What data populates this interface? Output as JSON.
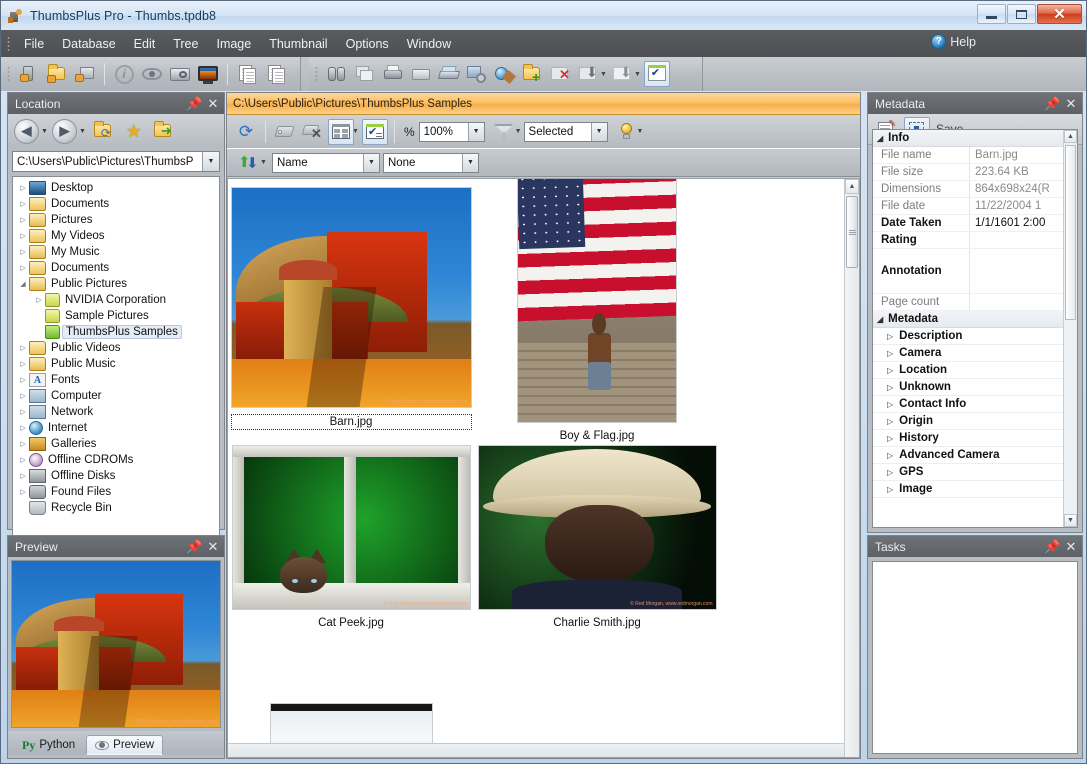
{
  "window": {
    "title": "ThumbsPlus Pro - Thumbs.tpdb8",
    "app_icon": "thumbsplus-icon",
    "minimize": "–",
    "maximize": "❐",
    "close": "✕"
  },
  "menubar": {
    "items": [
      "File",
      "Database",
      "Edit",
      "Tree",
      "Image",
      "Thumbnail",
      "Options",
      "Window"
    ],
    "help_label": "Help",
    "help_icon": "help-question-icon"
  },
  "toolbar": {
    "groups": [
      {
        "icons": [
          "thumbnail-scan-icon",
          "folder-scan-icon",
          "image-scan-icon"
        ]
      },
      {
        "icons": [
          "info-icon",
          "view-icon",
          "slideshow-icon",
          "fullscreen-view-icon"
        ]
      },
      {
        "icons": [
          "copy-icon",
          "paste-icon"
        ]
      },
      {
        "icons": [
          "find-icon",
          "duplicate-icon",
          "print-icon",
          "email-icon",
          "scanner-icon",
          "image-settings-icon",
          "web-gallery-icon",
          "new-folder-icon",
          "delete-folder-icon",
          "move-down-icon",
          "copy-down-icon",
          "select-checkbox-icon"
        ]
      }
    ]
  },
  "location_panel": {
    "caption": "Location",
    "pin_icon": "pin-icon",
    "close_icon": "close-icon",
    "nav": {
      "back_icon": "back-arrow-icon",
      "forward_icon": "forward-arrow-icon",
      "refresh_folder_icon": "refresh-folder-icon",
      "favorites_icon": "star-favorites-icon",
      "go_folder_icon": "go-folder-icon"
    },
    "path_value": "C:\\Users\\Public\\Pictures\\ThumbsP",
    "tree": [
      {
        "label": "Desktop",
        "icon": "desktop-icon",
        "indent": 0,
        "expander": "collapsed",
        "selected": false
      },
      {
        "label": "Documents",
        "icon": "documents-folder-icon",
        "indent": 0,
        "expander": "collapsed",
        "selected": false
      },
      {
        "label": "Pictures",
        "icon": "pictures-folder-icon",
        "indent": 0,
        "expander": "collapsed",
        "selected": false
      },
      {
        "label": "My Videos",
        "icon": "videos-folder-icon",
        "indent": 0,
        "expander": "collapsed",
        "selected": false
      },
      {
        "label": "My Music",
        "icon": "music-folder-icon",
        "indent": 0,
        "expander": "collapsed",
        "selected": false
      },
      {
        "label": "Documents",
        "icon": "documents-folder-icon",
        "indent": 0,
        "expander": "collapsed",
        "selected": false
      },
      {
        "label": "Public Pictures",
        "icon": "pictures-folder-icon",
        "indent": 0,
        "expander": "expanded",
        "selected": false
      },
      {
        "label": "NVIDIA Corporation",
        "icon": "plain-folder-icon",
        "indent": 1,
        "expander": "collapsed",
        "selected": false
      },
      {
        "label": "Sample Pictures",
        "icon": "plain-folder-icon",
        "indent": 1,
        "expander": "none",
        "selected": false
      },
      {
        "label": "ThumbsPlus Samples",
        "icon": "open-folder-icon",
        "indent": 1,
        "expander": "none",
        "selected": true
      },
      {
        "label": "Public Videos",
        "icon": "videos-folder-icon",
        "indent": 0,
        "expander": "collapsed",
        "selected": false
      },
      {
        "label": "Public Music",
        "icon": "music-folder-icon",
        "indent": 0,
        "expander": "collapsed",
        "selected": false
      },
      {
        "label": "Fonts",
        "icon": "fonts-icon",
        "indent": 0,
        "expander": "collapsed",
        "selected": false
      },
      {
        "label": "Computer",
        "icon": "computer-icon",
        "indent": 0,
        "expander": "collapsed",
        "selected": false
      },
      {
        "label": "Network",
        "icon": "network-icon",
        "indent": 0,
        "expander": "collapsed",
        "selected": false
      },
      {
        "label": "Internet",
        "icon": "globe-icon",
        "indent": 0,
        "expander": "collapsed",
        "selected": false
      },
      {
        "label": "Galleries",
        "icon": "galleries-icon",
        "indent": 0,
        "expander": "collapsed",
        "selected": false
      },
      {
        "label": "Offline CDROMs",
        "icon": "cdrom-icon",
        "indent": 0,
        "expander": "collapsed",
        "selected": false
      },
      {
        "label": "Offline Disks",
        "icon": "disk-icon",
        "indent": 0,
        "expander": "collapsed",
        "selected": false
      },
      {
        "label": "Found Files",
        "icon": "binoculars-icon",
        "indent": 0,
        "expander": "collapsed",
        "selected": false
      },
      {
        "label": "Recycle Bin",
        "icon": "recycle-bin-icon",
        "indent": 0,
        "expander": "none",
        "selected": false
      }
    ]
  },
  "preview_panel": {
    "caption": "Preview",
    "pin_icon": "pin-icon",
    "close_icon": "close-icon",
    "tabs": [
      {
        "label": "Python",
        "icon": "python-icon",
        "active": false
      },
      {
        "label": "Preview",
        "icon": "eye-icon",
        "active": true
      }
    ]
  },
  "browser": {
    "address": "C:\\Users\\Public\\Pictures\\ThumbsPlus Samples",
    "toolbar": {
      "refresh_icon": "refresh-thumbnails-icon",
      "tag_icon": "tag-icon",
      "untag_icon": "remove-tag-icon",
      "grid_view_icon": "grid-view-icon",
      "select_icon": "select-options-icon",
      "percent_label": "%",
      "zoom_value": "100%",
      "filter_icon": "filter-funnel-icon",
      "filter_value": "Selected",
      "lightbulb_icon": "lightbulb-icon"
    },
    "sort": {
      "sort_icon": "sort-ascending-icon",
      "sort_field": "Name",
      "group_field": "None"
    },
    "thumbnails": [
      {
        "label": "Barn.jpg",
        "art": "barn",
        "selected": true,
        "watermark": "© Red Morgan, www.redmorgan.com"
      },
      {
        "label": "Boy & Flag.jpg",
        "art": "flag",
        "selected": false,
        "watermark": ""
      },
      {
        "label": "Cat Peek.jpg",
        "art": "cat",
        "selected": false,
        "watermark": "© Red Morgan, www.redmorgan.com"
      },
      {
        "label": "Charlie Smith.jpg",
        "art": "charlie",
        "selected": false,
        "watermark": "© Red Morgan, www.redmorgan.com"
      },
      {
        "label": "",
        "art": "ice",
        "selected": false,
        "watermark": ""
      }
    ]
  },
  "metadata_panel": {
    "caption": "Metadata",
    "pin_icon": "pin-icon",
    "close_icon": "close-icon",
    "toolbar": {
      "properties_icon": "properties-icon",
      "edit_icon": "edit-metadata-icon",
      "save_label": "Save"
    },
    "info_group": "Info",
    "info_rows": [
      {
        "key": "File name",
        "value": "Barn.jpg",
        "strong": false
      },
      {
        "key": "File size",
        "value": "223.64 KB",
        "strong": false
      },
      {
        "key": "Dimensions",
        "value": "864x698x24(R",
        "strong": false
      },
      {
        "key": "File date",
        "value": "11/22/2004  1",
        "strong": false
      },
      {
        "key": "Date Taken",
        "value": "1/1/1601  2:00",
        "strong": true
      },
      {
        "key": "Rating",
        "value": "",
        "strong": true
      },
      {
        "key": "Annotation",
        "value": "",
        "strong": true
      },
      {
        "key": "Page count",
        "value": "",
        "strong": false
      }
    ],
    "metadata_group": "Metadata",
    "metadata_subgroups": [
      "Description",
      "Camera",
      "Location",
      "Unknown",
      "Contact Info",
      "Origin",
      "History",
      "Advanced Camera",
      "GPS",
      "Image"
    ]
  },
  "tasks_panel": {
    "caption": "Tasks",
    "pin_icon": "pin-icon",
    "close_icon": "close-icon"
  },
  "colors": {
    "accent_orange": "#f7ae44",
    "menu_bar": "#4e5054",
    "panel_caption": "#64686c",
    "close_button": "#cf3c18"
  }
}
